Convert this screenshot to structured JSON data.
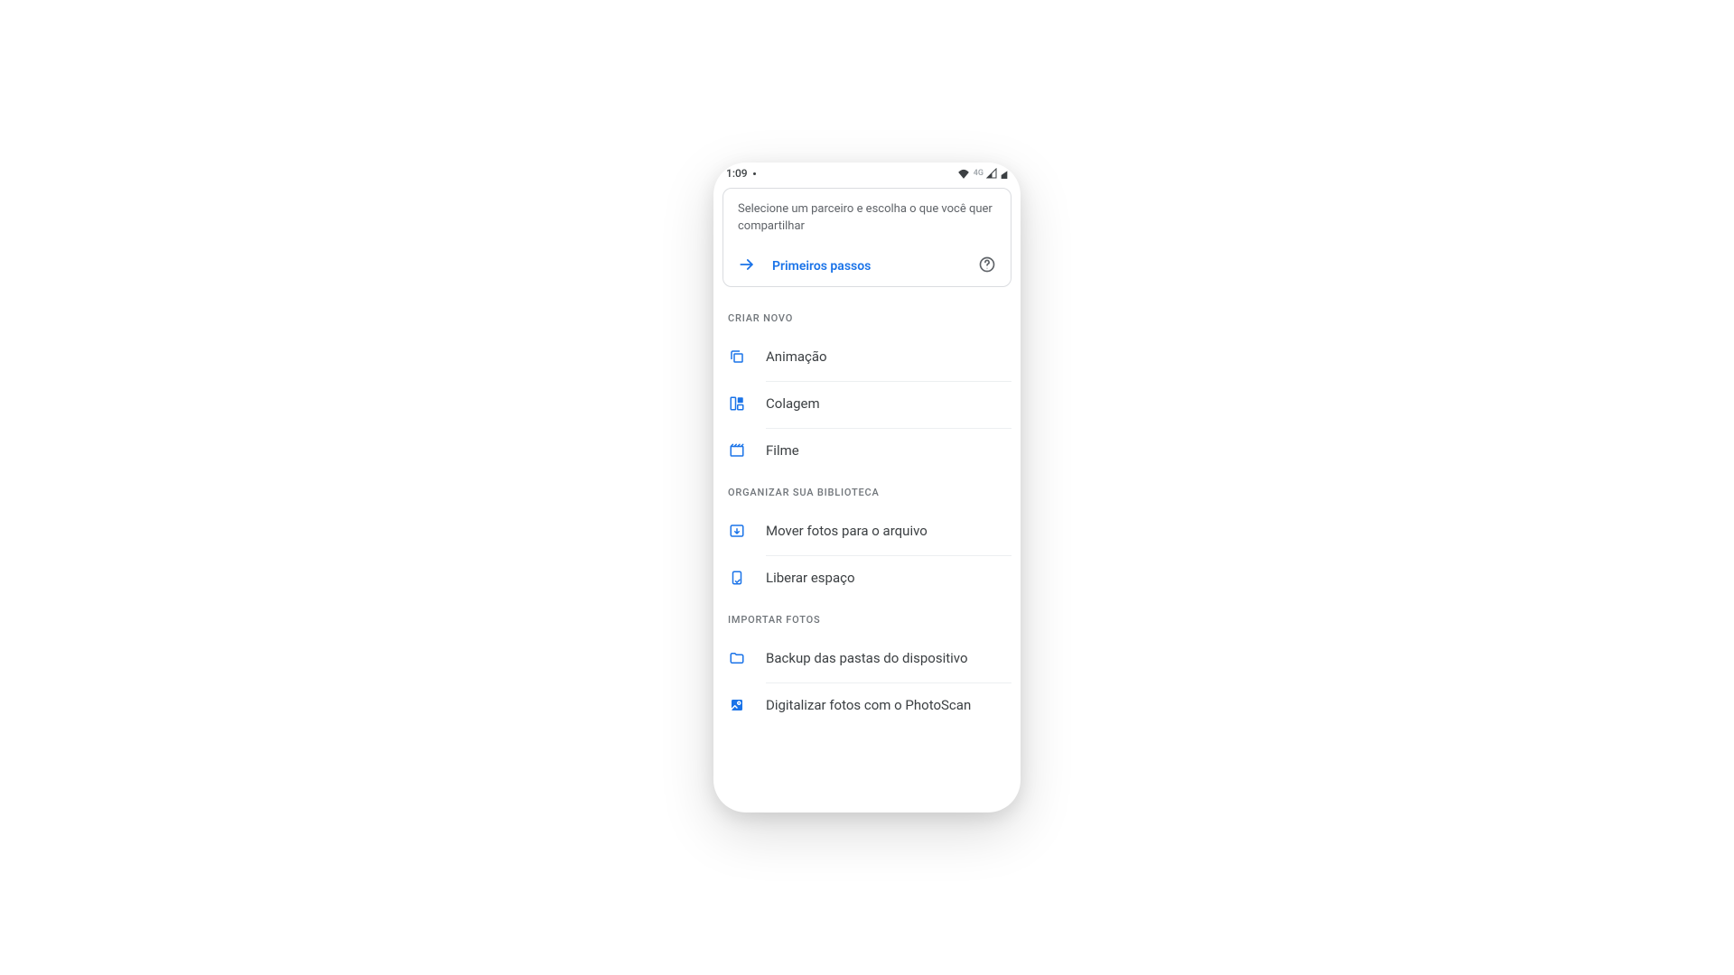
{
  "statusbar": {
    "time": "1:09",
    "network": "4G"
  },
  "card": {
    "subtitle": "Selecione um parceiro e escolha o que você quer compartilhar",
    "cta": "Primeiros passos"
  },
  "sections": {
    "create": {
      "title": "CRIAR NOVO",
      "items": [
        {
          "label": "Animação"
        },
        {
          "label": "Colagem"
        },
        {
          "label": "Filme"
        }
      ]
    },
    "organize": {
      "title": "ORGANIZAR SUA BIBLIOTECA",
      "items": [
        {
          "label": "Mover fotos para o arquivo"
        },
        {
          "label": "Liberar espaço"
        }
      ]
    },
    "import": {
      "title": "IMPORTAR FOTOS",
      "items": [
        {
          "label": "Backup das pastas do dispositivo"
        },
        {
          "label": "Digitalizar fotos com o PhotoScan"
        }
      ]
    }
  }
}
